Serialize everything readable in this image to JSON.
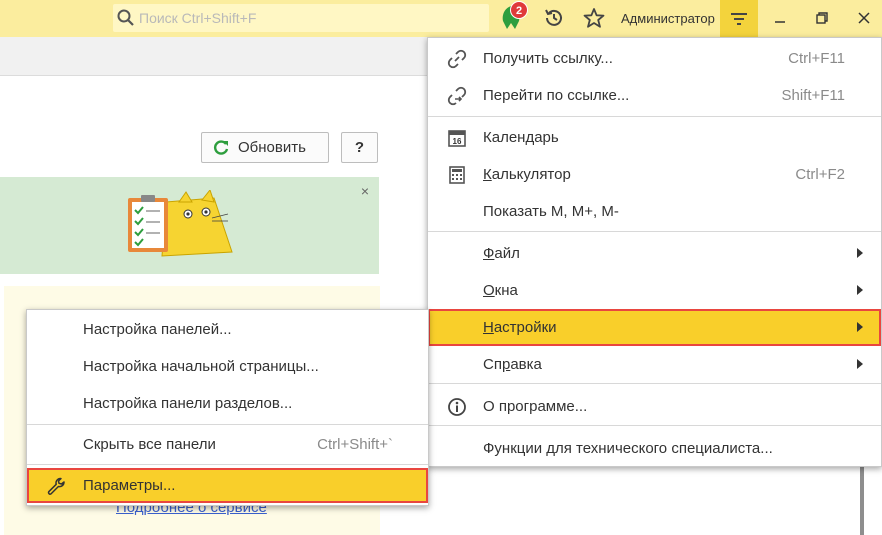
{
  "topbar": {
    "search_placeholder": "Поиск Ctrl+Shift+F",
    "notification_count": "2",
    "user_name": "Администратор"
  },
  "toolbar": {
    "refresh_label": "Обновить",
    "help_label": "?"
  },
  "banner": {
    "close_label": "×"
  },
  "info": {
    "more_link": "Подробнее о сервисе"
  },
  "main_menu": {
    "items": [
      {
        "label": "Получить ссылку...",
        "shortcut": "Ctrl+F11",
        "icon": "link-icon"
      },
      {
        "label": "Перейти по ссылке...",
        "shortcut": "Shift+F11",
        "icon": "goto-link-icon"
      },
      {
        "label": "Календарь",
        "shortcut": "",
        "icon": "calendar-icon",
        "icon_text": "16"
      },
      {
        "label": "Калькулятор",
        "shortcut": "Ctrl+F2",
        "icon": "calculator-icon"
      },
      {
        "label": "Показать М, М+, М-",
        "shortcut": "",
        "icon": ""
      },
      {
        "label": "Файл",
        "submenu": true
      },
      {
        "label": "Окна",
        "submenu": true
      },
      {
        "label": "Настройки",
        "submenu": true,
        "highlighted": true
      },
      {
        "label": "Справка",
        "submenu": true
      },
      {
        "label": "О программе...",
        "icon": "info-icon"
      },
      {
        "label": "Функции для технического специалиста..."
      }
    ]
  },
  "settings_submenu": {
    "items": [
      {
        "label": "Настройка панелей..."
      },
      {
        "label": "Настройка начальной страницы..."
      },
      {
        "label": "Настройка панели разделов..."
      },
      {
        "label": "Скрыть все панели",
        "shortcut": "Ctrl+Shift+`"
      },
      {
        "label": "Параметры...",
        "icon": "wrench-icon",
        "highlighted": true
      }
    ]
  },
  "colors": {
    "topbar": "#fbed9e",
    "highlight": "#f9cf2a",
    "highlight_border": "#e9463f",
    "banner_green": "#d5ead3",
    "info_yellow": "#fefbe6"
  }
}
